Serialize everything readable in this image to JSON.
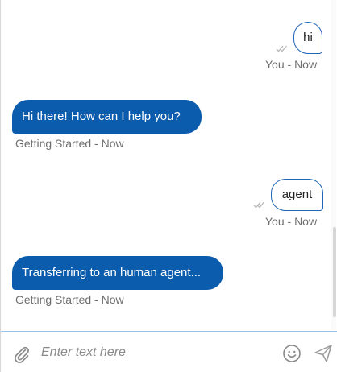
{
  "conversation": {
    "messages": [
      {
        "sender": "user",
        "text": "hi",
        "meta": "You - Now"
      },
      {
        "sender": "bot",
        "text": "Hi there! How can I help you?",
        "meta": "Getting Started - Now"
      },
      {
        "sender": "user",
        "text": "agent",
        "meta": "You - Now"
      },
      {
        "sender": "bot",
        "text": "Transferring to an human agent...",
        "meta": "Getting Started - Now"
      }
    ]
  },
  "composer": {
    "placeholder": "Enter text here",
    "attach_icon": "paperclip-icon",
    "emoji_icon": "smiley-icon",
    "send_icon": "send-icon"
  },
  "colors": {
    "bot_bubble": "#0b5cad",
    "user_bubble_border": "#1f66b8",
    "meta_text": "#6e6e6e",
    "composer_border": "#9cc0e8"
  }
}
